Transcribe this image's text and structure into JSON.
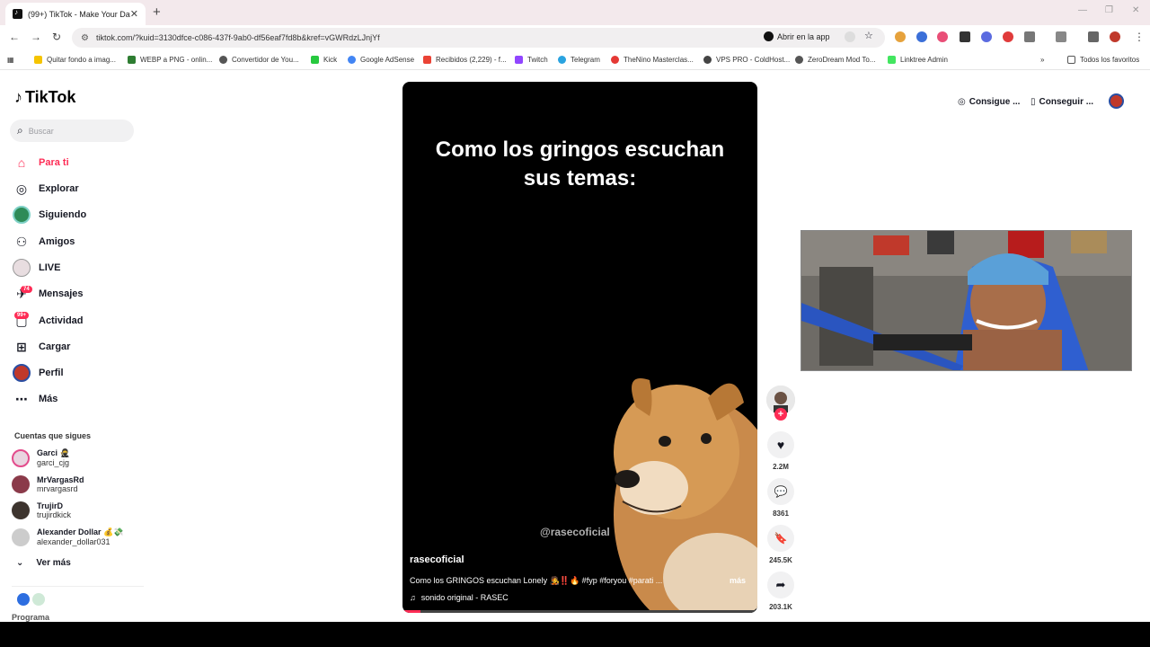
{
  "browser": {
    "tab_title": "(99+) TikTok - Make Your Day",
    "url": "tiktok.com/?kuid=3130dfce-c086-437f-9ab0-df56eaf7fd8b&kref=vGWRdzLJnjYf",
    "open_app_label": "Abrir en la app",
    "bookmarks": [
      "Quitar fondo a imag...",
      "WEBP a PNG - onlin...",
      "Convertidor de You...",
      "Kick",
      "Google AdSense",
      "Recibidos (2,229) - f...",
      "Twitch",
      "Telegram",
      "TheNino Masterclas...",
      "VPS PRO - ColdHost...",
      "ZeroDream Mod To...",
      "Linktree Admin"
    ],
    "all_bookmarks_label": "Todos los favoritos"
  },
  "sidebar": {
    "logo": "TikTok",
    "search_placeholder": "Buscar",
    "nav": [
      {
        "label": "Para ti",
        "icon": "home-icon"
      },
      {
        "label": "Explorar",
        "icon": "compass-icon"
      },
      {
        "label": "Siguiendo",
        "icon": "following-avatar-icon"
      },
      {
        "label": "Amigos",
        "icon": "friends-icon"
      },
      {
        "label": "LIVE",
        "icon": "live-icon"
      },
      {
        "label": "Mensajes",
        "icon": "messages-icon",
        "badge": "74"
      },
      {
        "label": "Actividad",
        "icon": "activity-icon",
        "badge": "99+"
      },
      {
        "label": "Cargar",
        "icon": "upload-icon"
      },
      {
        "label": "Perfil",
        "icon": "profile-icon"
      },
      {
        "label": "Más",
        "icon": "more-icon"
      }
    ],
    "following_title": "Cuentas que sigues",
    "accounts": [
      {
        "name": "Garci 🥷",
        "handle": "garci_cjg"
      },
      {
        "name": "MrVargasRd",
        "handle": "mrvargasrd"
      },
      {
        "name": "TrujirD",
        "handle": "trujirdkick"
      },
      {
        "name": "Alexander Dollar 💰💸",
        "handle": "alexander_dollar031"
      }
    ],
    "see_more": "Ver más",
    "program_label": "Programa"
  },
  "video": {
    "caption_line1": "Como los gringos escuchan",
    "caption_line2": "sus temas:",
    "watermark": "@rasecoficial",
    "username": "rasecoficial",
    "description": "Como los GRINGOS escuchan Lonely 🧑‍🎤‼️🔥 #fyp #foryou #parati ...",
    "more_label": "más",
    "sound": "sonido original - RASEC",
    "progress": 0.05
  },
  "actions": {
    "likes": "2.2M",
    "comments": "8361",
    "saves": "245.5K",
    "shares": "203.1K"
  },
  "header": {
    "coins_label": "Consigue ...",
    "app_label": "Conseguir ..."
  },
  "colors": {
    "accent": "#fe2c55"
  }
}
